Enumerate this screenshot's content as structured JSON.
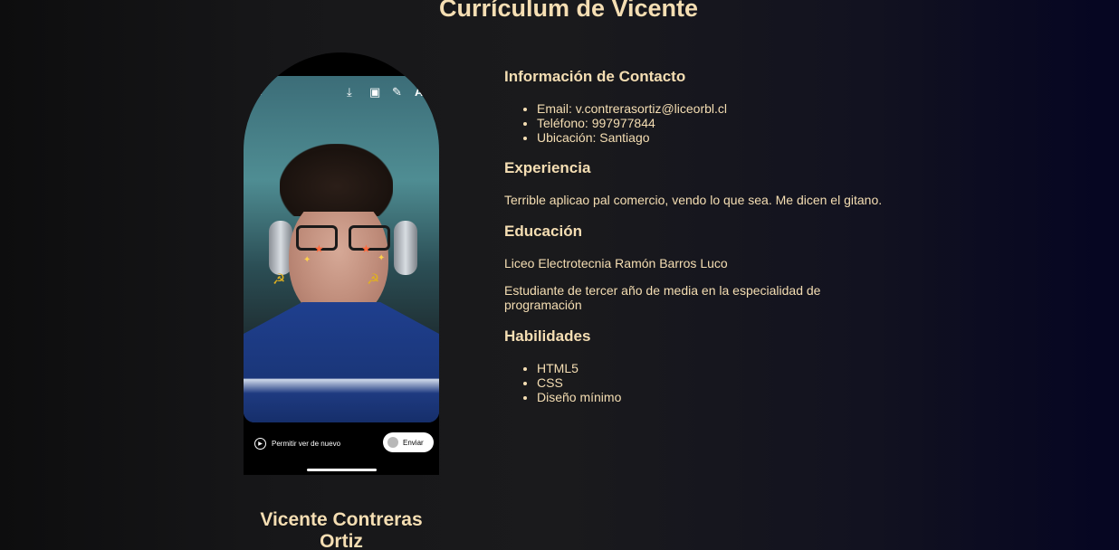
{
  "page": {
    "title": "Currículum de Vicente"
  },
  "profile": {
    "name": "Vicente Contreras Ortiz",
    "photo": {
      "replay_label": "Permitir ver de nuevo",
      "send_label": "Enviar",
      "icons": [
        "back-icon",
        "download-icon",
        "sticker-icon",
        "draw-icon",
        "text-icon"
      ],
      "emoji": [
        "hammer-sickle-icon",
        "star-icon"
      ]
    }
  },
  "contact": {
    "heading": "Información de Contacto",
    "items": [
      "Email: v.contrerasortiz@liceorbl.cl",
      "Teléfono: 997977844",
      "Ubicación: Santiago"
    ]
  },
  "experience": {
    "heading": "Experiencia",
    "text": "Terrible aplicao pal comercio, vendo lo que sea. Me dicen el gitano."
  },
  "education": {
    "heading": "Educación",
    "school": "Liceo Electrotecnia Ramón Barros Luco",
    "detail": "Estudiante de tercer año de media en la especialidad de programación"
  },
  "skills": {
    "heading": "Habilidades",
    "items": [
      "HTML5",
      "CSS",
      "Diseño mínimo"
    ]
  },
  "colors": {
    "accent": "#f5deb3",
    "background": "#1a1a1c"
  }
}
